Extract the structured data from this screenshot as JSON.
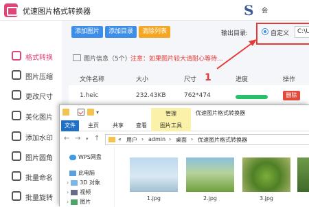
{
  "app": {
    "title": "优速图片格式转换器",
    "user_text": "会"
  },
  "sidebar": {
    "items": [
      {
        "label": "格式转换",
        "active": true
      },
      {
        "label": "图片压缩"
      },
      {
        "label": "更改尺寸"
      },
      {
        "label": "美化图片"
      },
      {
        "label": "添加水印"
      },
      {
        "label": "图片圆角"
      },
      {
        "label": "批量命名"
      },
      {
        "label": "批量旋转"
      }
    ]
  },
  "toolbar": {
    "add_image": "添加图片",
    "add_folder": "添加目录",
    "clear_list": "清除列表",
    "output_label": "输出目录:",
    "custom_label": "自定义",
    "path_value": "C:\\U"
  },
  "info": {
    "label": "图片信息（5个）",
    "warning": "注意：如果图片较大请耐心等待..."
  },
  "table": {
    "headers": [
      "文件名称",
      "大小",
      "尺寸",
      "进度",
      "操作"
    ],
    "rows": [
      {
        "name": "1.heic",
        "size": "232.43KB",
        "dims": "762*474",
        "progress": 1.0,
        "action": "删除"
      }
    ]
  },
  "annotation": {
    "number": "1"
  },
  "explorer": {
    "manage_tab": "管理",
    "title": "优速图片格式转换器",
    "ribbon_tabs": [
      "文件",
      "主页",
      "共享",
      "查看",
      "图片工具"
    ],
    "breadcrumbs": [
      "«",
      "用户",
      "›",
      "admin",
      "›",
      "桌面",
      "›",
      "优速图片格式转换器"
    ],
    "tree": [
      {
        "label": "WPS网盘"
      },
      {
        "label": "此电脑"
      },
      {
        "label": "3D 对象"
      },
      {
        "label": "视频"
      },
      {
        "label": "图片"
      }
    ],
    "files": [
      {
        "name": "1.jpg"
      },
      {
        "name": "2.jpg"
      },
      {
        "name": "3.jpg"
      },
      {
        "name": ""
      }
    ]
  },
  "colors": {
    "accent": "#e0457a",
    "blue": "#3d8ee8",
    "orange": "#f5a623",
    "red": "#e53935",
    "green": "#27c06b"
  }
}
